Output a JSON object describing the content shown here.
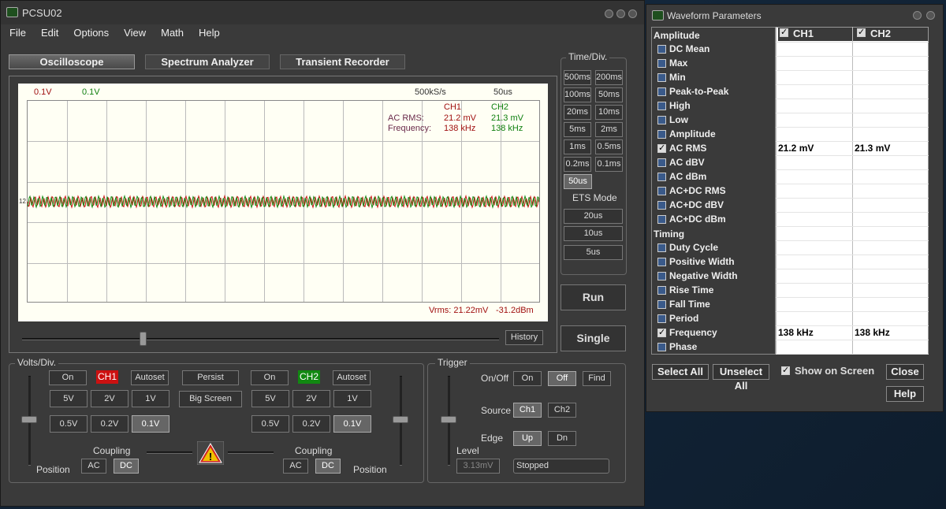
{
  "main": {
    "title": "PCSU02",
    "menu": [
      "File",
      "Edit",
      "Options",
      "View",
      "Math",
      "Help"
    ],
    "tabs": [
      "Oscilloscope",
      "Spectrum Analyzer",
      "Transient Recorder"
    ]
  },
  "screen": {
    "ch1_volts": "0.1V",
    "ch2_volts": "0.1V",
    "sample_rate": "500kS/s",
    "timebase": "50us",
    "hdr_ch1": "CH1",
    "hdr_ch2": "CH2",
    "acrms_label": "AC RMS:",
    "acrms_ch1": "21.2 mV",
    "acrms_ch2": "21.3 mV",
    "freq_label": "Frequency:",
    "freq_ch1": "138 kHz",
    "freq_ch2": "138 kHz",
    "marker": "12",
    "vrms": "Vrms: 21.22mV",
    "dbm": "-31.2dBm",
    "history": "History"
  },
  "timediv": {
    "label": "Time/Div.",
    "buttons": [
      "500ms",
      "200ms",
      "100ms",
      "50ms",
      "20ms",
      "10ms",
      "5ms",
      "2ms",
      "1ms",
      "0.5ms",
      "0.2ms",
      "0.1ms",
      "50us"
    ],
    "ets_label": "ETS Mode",
    "ets": [
      "20us",
      "10us",
      "5us"
    ],
    "run": "Run",
    "single": "Single"
  },
  "volts": {
    "label": "Volts/Div.",
    "on": "On",
    "ch1": "CH1",
    "ch2": "CH2",
    "autoset": "Autoset",
    "persist": "Persist",
    "big_screen": "Big Screen",
    "ranges_top": [
      "5V",
      "2V",
      "1V"
    ],
    "ranges_bottom": [
      "0.5V",
      "0.2V",
      "0.1V"
    ],
    "coupling": "Coupling",
    "ac": "AC",
    "dc": "DC",
    "position": "Position",
    "ch1_color": "#cc1111",
    "ch2_color": "#118811"
  },
  "trigger": {
    "label": "Trigger",
    "onoff": "On/Off",
    "on": "On",
    "off": "Off",
    "find": "Find",
    "source": "Source",
    "ch1": "Ch1",
    "ch2": "Ch2",
    "edge": "Edge",
    "up": "Up",
    "dn": "Dn",
    "level": "Level",
    "level_value": "3.13mV",
    "status": "Stopped"
  },
  "params": {
    "title": "Waveform Parameters",
    "col1": "CH1",
    "col2": "CH2",
    "rows": [
      {
        "type": "section",
        "label": "Amplitude"
      },
      {
        "label": "DC  Mean",
        "checked": false,
        "v1": "",
        "v2": ""
      },
      {
        "label": "Max",
        "checked": false,
        "v1": "",
        "v2": ""
      },
      {
        "label": "Min",
        "checked": false,
        "v1": "",
        "v2": ""
      },
      {
        "label": "Peak-to-Peak",
        "checked": false,
        "v1": "",
        "v2": ""
      },
      {
        "label": "High",
        "checked": false,
        "v1": "",
        "v2": ""
      },
      {
        "label": "Low",
        "checked": false,
        "v1": "",
        "v2": ""
      },
      {
        "label": "Amplitude",
        "checked": false,
        "v1": "",
        "v2": ""
      },
      {
        "label": "AC RMS",
        "checked": true,
        "v1": "21.2 mV",
        "v2": "21.3 mV"
      },
      {
        "label": "AC dBV",
        "checked": false,
        "v1": "",
        "v2": ""
      },
      {
        "label": "AC dBm",
        "checked": false,
        "v1": "",
        "v2": ""
      },
      {
        "label": "AC+DC RMS",
        "checked": false,
        "v1": "",
        "v2": ""
      },
      {
        "label": "AC+DC dBV",
        "checked": false,
        "v1": "",
        "v2": ""
      },
      {
        "label": "AC+DC dBm",
        "checked": false,
        "v1": "",
        "v2": ""
      },
      {
        "type": "section",
        "label": "Timing"
      },
      {
        "label": "Duty Cycle",
        "checked": false,
        "v1": "",
        "v2": ""
      },
      {
        "label": "Positive Width",
        "checked": false,
        "v1": "",
        "v2": ""
      },
      {
        "label": "Negative Width",
        "checked": false,
        "v1": "",
        "v2": ""
      },
      {
        "label": "Rise Time",
        "checked": false,
        "v1": "",
        "v2": ""
      },
      {
        "label": "Fall Time",
        "checked": false,
        "v1": "",
        "v2": ""
      },
      {
        "label": "Period",
        "checked": false,
        "v1": "",
        "v2": ""
      },
      {
        "label": "Frequency",
        "checked": true,
        "v1": "138 kHz",
        "v2": "138 kHz"
      },
      {
        "label": "Phase",
        "checked": false,
        "v1": "",
        "v2": ""
      }
    ],
    "select_all": "Select All",
    "unselect_all": "Unselect All",
    "show_on_screen": "Show on Screen",
    "close": "Close",
    "help": "Help"
  }
}
